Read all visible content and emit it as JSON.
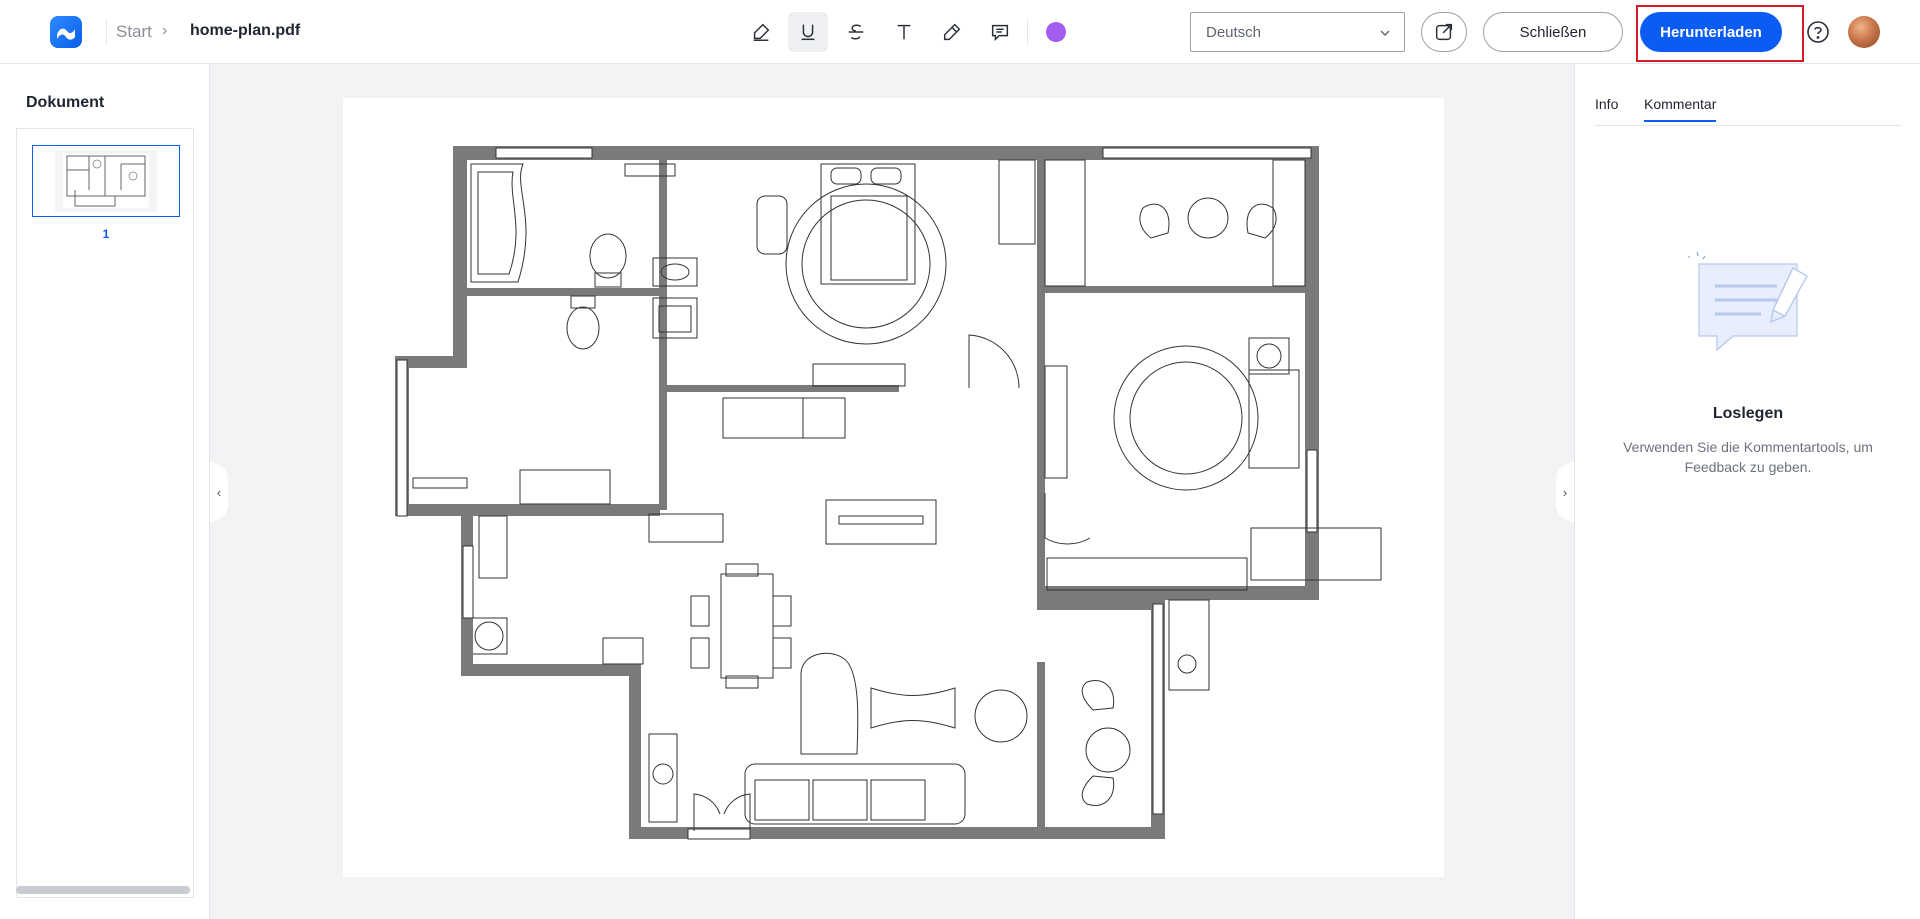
{
  "header": {
    "breadcrumb_start": "Start",
    "breadcrumb_chevron": "›",
    "file_name": "home-plan.pdf",
    "language_selected": "Deutsch",
    "close_label": "Schließen",
    "download_label": "Herunterladen"
  },
  "toolbar": {
    "tools": [
      "highlighter-icon",
      "underline-icon",
      "strikethrough-icon",
      "text-icon",
      "eraser-icon",
      "comment-icon"
    ],
    "active_tool": "underline-icon",
    "current_color": "#a35cf0"
  },
  "left_panel": {
    "title": "Dokument",
    "pages": [
      {
        "number": "1"
      }
    ]
  },
  "right_panel": {
    "tabs": [
      {
        "label": "Info"
      },
      {
        "label": "Kommentar"
      }
    ],
    "active_tab": "Kommentar",
    "empty_title": "Loslegen",
    "empty_text": "Verwenden Sie die Kommentartools, um Feedback zu geben."
  },
  "colors": {
    "accent": "#0b5cf5",
    "highlight_outline": "#d8192c",
    "wall": "#7a7a7a"
  }
}
